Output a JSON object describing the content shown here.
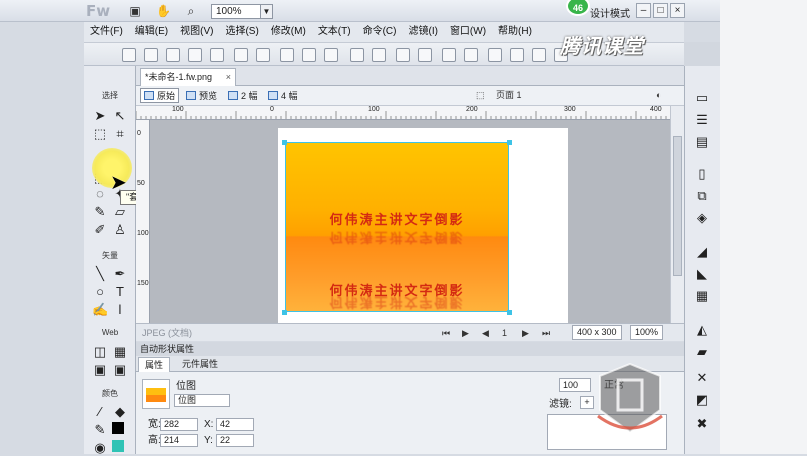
{
  "app": {
    "logo": "Fw",
    "zoom": "100%",
    "badge": "46",
    "mode_label": "设计模式"
  },
  "window_buttons": [
    "–",
    "□",
    "×"
  ],
  "menu": [
    "文件(F)",
    "编辑(E)",
    "视图(V)",
    "选择(S)",
    "修改(M)",
    "文本(T)",
    "命令(C)",
    "滤镜(I)",
    "窗口(W)",
    "帮助(H)"
  ],
  "watermark": "腾讯课堂",
  "document": {
    "tab_title": "*未命名-1.fw.png",
    "view_modes": [
      "原始",
      "预览",
      "2 幅",
      "4 幅"
    ],
    "page_label": "页面 1",
    "art_text": "何伟涛主讲文字倒影",
    "status_format": "JPEG (文档)",
    "frame": "1",
    "size": "400 x 300",
    "zoom": "100%"
  },
  "tools": {
    "sections": [
      "选择",
      "位图",
      "矢量",
      "Web",
      "颜色"
    ],
    "tooltip": "\"套索\" 工具 (L)"
  },
  "ruler": {
    "h_ticks": [
      "100",
      "0",
      "100",
      "200",
      "300",
      "400",
      "500"
    ],
    "v_ticks": [
      "0",
      "50",
      "100",
      "150",
      "200"
    ]
  },
  "properties": {
    "title": "自动形状属性",
    "tabs": [
      "属性",
      "元件属性"
    ],
    "object_type": "位图",
    "name": "位图",
    "w_label": "宽:",
    "w": "282",
    "h_label": "高:",
    "h": "214",
    "x_label": "X:",
    "x": "42",
    "y_label": "Y:",
    "y": "22",
    "opacity": "100",
    "blend": "正常",
    "filters_label": "滤镜:"
  },
  "colors": {
    "accent": "#3ec3e6",
    "art_top": "#ffc400",
    "art_bottom": "#ff8a10",
    "art_text": "#d42a12"
  }
}
